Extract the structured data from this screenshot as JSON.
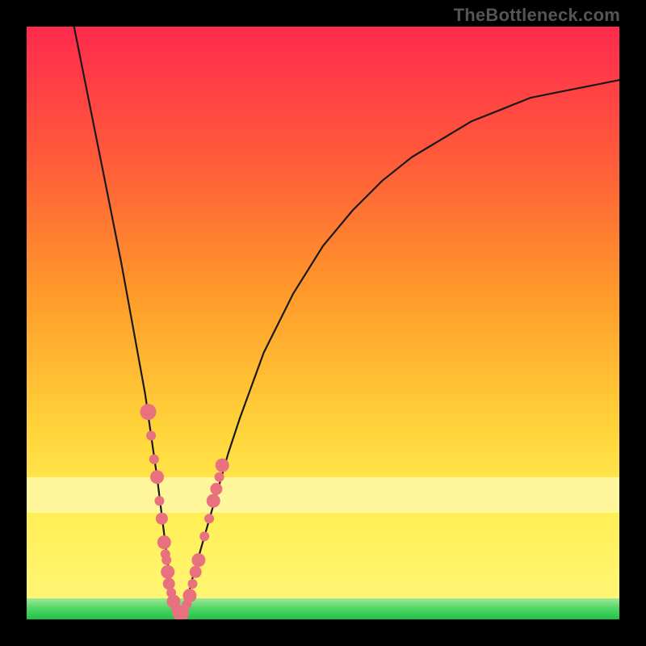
{
  "watermark": "TheBottleneck.com",
  "colors": {
    "frame": "#000000",
    "top": "#ff2a4e",
    "mid_upper": "#ff8a2a",
    "mid": "#ffe23a",
    "band_light": "#fff59a",
    "green_band_top": "#7de07a",
    "green_band_bottom": "#23d34a",
    "curve_stroke": "#1a1a1a",
    "marker_fill": "#e9707e",
    "marker_stroke": "#d85e6e"
  },
  "chart_data": {
    "type": "line",
    "title": "",
    "xlabel": "",
    "ylabel": "",
    "xlim": [
      0,
      100
    ],
    "ylim": [
      0,
      100
    ],
    "grid": false,
    "legend": false,
    "series": [
      {
        "name": "bottleneck-curve",
        "x": [
          8,
          10,
          12,
          14,
          16,
          18,
          20,
          22,
          23,
          24,
          25,
          26,
          27,
          28,
          30,
          32,
          34,
          36,
          40,
          45,
          50,
          55,
          60,
          65,
          70,
          75,
          80,
          85,
          90,
          95,
          100
        ],
        "y": [
          100,
          90,
          80,
          70,
          60,
          49,
          38,
          24,
          16,
          8,
          3,
          1,
          3,
          7,
          14,
          21,
          28,
          34,
          45,
          55,
          63,
          69,
          74,
          78,
          81,
          84,
          86,
          88,
          89,
          90,
          91
        ]
      }
    ],
    "markers": {
      "name": "sample-points",
      "points": [
        {
          "x": 20.5,
          "y": 35
        },
        {
          "x": 21.0,
          "y": 31
        },
        {
          "x": 21.5,
          "y": 27
        },
        {
          "x": 22.0,
          "y": 24
        },
        {
          "x": 22.4,
          "y": 20
        },
        {
          "x": 22.8,
          "y": 17
        },
        {
          "x": 23.2,
          "y": 13
        },
        {
          "x": 23.4,
          "y": 11
        },
        {
          "x": 23.6,
          "y": 10
        },
        {
          "x": 23.8,
          "y": 8
        },
        {
          "x": 24.0,
          "y": 6
        },
        {
          "x": 24.4,
          "y": 4.5
        },
        {
          "x": 24.8,
          "y": 3
        },
        {
          "x": 25.2,
          "y": 1.8
        },
        {
          "x": 25.6,
          "y": 1.2
        },
        {
          "x": 26.0,
          "y": 1.0
        },
        {
          "x": 26.5,
          "y": 1.5
        },
        {
          "x": 27.0,
          "y": 2.5
        },
        {
          "x": 27.5,
          "y": 4
        },
        {
          "x": 28.0,
          "y": 6
        },
        {
          "x": 28.5,
          "y": 8
        },
        {
          "x": 29.0,
          "y": 10
        },
        {
          "x": 30.0,
          "y": 14
        },
        {
          "x": 30.8,
          "y": 17
        },
        {
          "x": 31.5,
          "y": 20
        },
        {
          "x": 32.0,
          "y": 22
        },
        {
          "x": 32.5,
          "y": 24
        },
        {
          "x": 33.0,
          "y": 26
        }
      ]
    },
    "bands": [
      {
        "name": "light-yellow-band",
        "y0": 18,
        "y1": 24,
        "color": "#fff59a"
      },
      {
        "name": "green-band",
        "y0": 0,
        "y1": 3.5,
        "color_top": "#7de07a",
        "color_bottom": "#23d34a"
      }
    ]
  }
}
